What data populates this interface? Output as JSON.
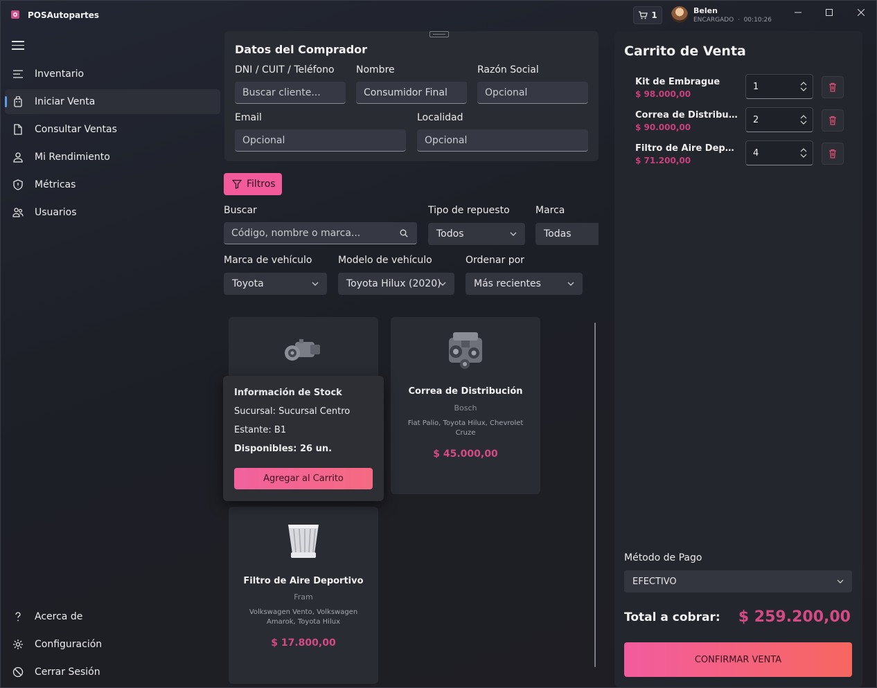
{
  "app": {
    "title": "POSAutopartes"
  },
  "header": {
    "cart_count": "1",
    "user_name": "Belen",
    "user_role": "ENCARGADO",
    "session_time": "00:10:26"
  },
  "sidebar": {
    "items": [
      {
        "label": "Inventario",
        "icon": "list-icon"
      },
      {
        "label": "Iniciar Venta",
        "icon": "bag-icon",
        "active": true
      },
      {
        "label": "Consultar Ventas",
        "icon": "document-icon"
      },
      {
        "label": "Mi Rendimiento",
        "icon": "person-icon"
      },
      {
        "label": "Métricas",
        "icon": "shield-icon"
      },
      {
        "label": "Usuarios",
        "icon": "users-icon"
      }
    ],
    "bottom_items": [
      {
        "label": "Acerca de",
        "icon": "question-icon"
      },
      {
        "label": "Configuración",
        "icon": "gear-icon"
      },
      {
        "label": "Cerrar Sesión",
        "icon": "logout-icon"
      }
    ]
  },
  "buyer": {
    "title": "Datos del Comprador",
    "fields": {
      "dni": {
        "label": "DNI / CUIT / Teléfono",
        "placeholder": "Buscar cliente..."
      },
      "nombre": {
        "label": "Nombre",
        "value": "Consumidor Final"
      },
      "razon": {
        "label": "Razón Social",
        "placeholder": "Opcional"
      },
      "email": {
        "label": "Email",
        "placeholder": "Opcional"
      },
      "localidad": {
        "label": "Localidad",
        "placeholder": "Opcional"
      }
    }
  },
  "filters": {
    "button_label": "Filtros",
    "buscar": {
      "label": "Buscar",
      "placeholder": "Código, nombre o marca..."
    },
    "tipo": {
      "label": "Tipo de repuesto",
      "value": "Todos"
    },
    "marca": {
      "label": "Marca",
      "value": "Todas"
    },
    "marca_vehiculo": {
      "label": "Marca de vehículo",
      "value": "Toyota"
    },
    "modelo": {
      "label": "Modelo de vehículo",
      "value": "Toyota Hilux (2020)"
    },
    "orden": {
      "label": "Ordenar por",
      "value": "Más recientes"
    }
  },
  "products": [
    {
      "name": "Correa de Distribución",
      "brand": "Bosch",
      "compat": "Fiat Palio, Toyota Hilux, Chevrolet Cruze",
      "price": "$ 45.000,00"
    },
    {
      "name": "Filtro de Aire Deportivo",
      "brand": "Fram",
      "compat": "Volkswagen Vento, Volkswagen Amarok, Toyota Hilux",
      "price": "$ 17.800,00"
    }
  ],
  "stock_popup": {
    "title": "Información de Stock",
    "sucursal": "Sucursal: Sucursal Centro",
    "estante": "Estante: B1",
    "disponibles": "Disponibles: 26 un.",
    "add_label": "Agregar al Carrito"
  },
  "cart": {
    "title": "Carrito de Venta",
    "items": [
      {
        "name": "Kit de Embrague",
        "price": "$ 98.000,00",
        "qty": "1"
      },
      {
        "name": "Correa de Distribución",
        "price": "$ 90.000,00",
        "qty": "2"
      },
      {
        "name": "Filtro de Aire Deportivo",
        "price": "$ 71.200,00",
        "qty": "4"
      }
    ],
    "payment_label": "Método de Pago",
    "payment_value": "EFECTIVO",
    "total_label": "Total a cobrar:",
    "total_value": "$ 259.200,00",
    "confirm_label": "CONFIRMAR VENTA"
  },
  "colors": {
    "accent": "#f25a9a",
    "price": "#d44a85",
    "active_indicator": "#5b9ee8"
  }
}
